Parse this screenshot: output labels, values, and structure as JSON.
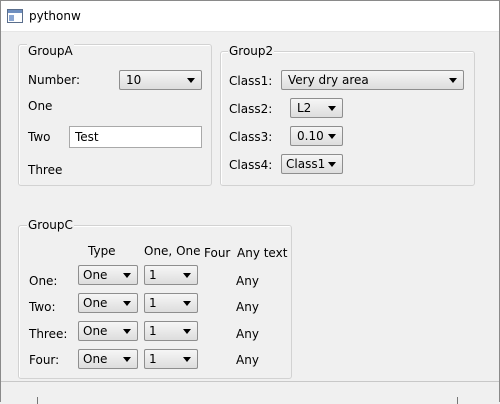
{
  "window": {
    "title": "pythonw",
    "app_icon": "python-window-icon"
  },
  "groupA": {
    "title": "GroupA",
    "number_label": "Number:",
    "number_value": "10",
    "one_label": "One",
    "two_label": "Two",
    "two_value": "Test",
    "three_label": "Three"
  },
  "group2": {
    "title": "Group2",
    "class1_label": "Class1:",
    "class1_value": "Very dry area",
    "class2_label": "Class2:",
    "class2_value": "L2",
    "class3_label": "Class3:",
    "class3_value": "0.10",
    "class4_label": "Class4:",
    "class4_value": "Class1"
  },
  "groupC": {
    "title": "GroupC",
    "headers": {
      "type": "Type",
      "one_one": "One, One",
      "four": "Four",
      "any_text": "Any text"
    },
    "rows": [
      {
        "label": "One:",
        "type": "One",
        "num": "1",
        "any": "Any"
      },
      {
        "label": "Two:",
        "type": "One",
        "num": "1",
        "any": "Any"
      },
      {
        "label": "Three:",
        "type": "One",
        "num": "1",
        "any": "Any"
      },
      {
        "label": "Four:",
        "type": "One",
        "num": "1",
        "any": "Any"
      }
    ]
  }
}
